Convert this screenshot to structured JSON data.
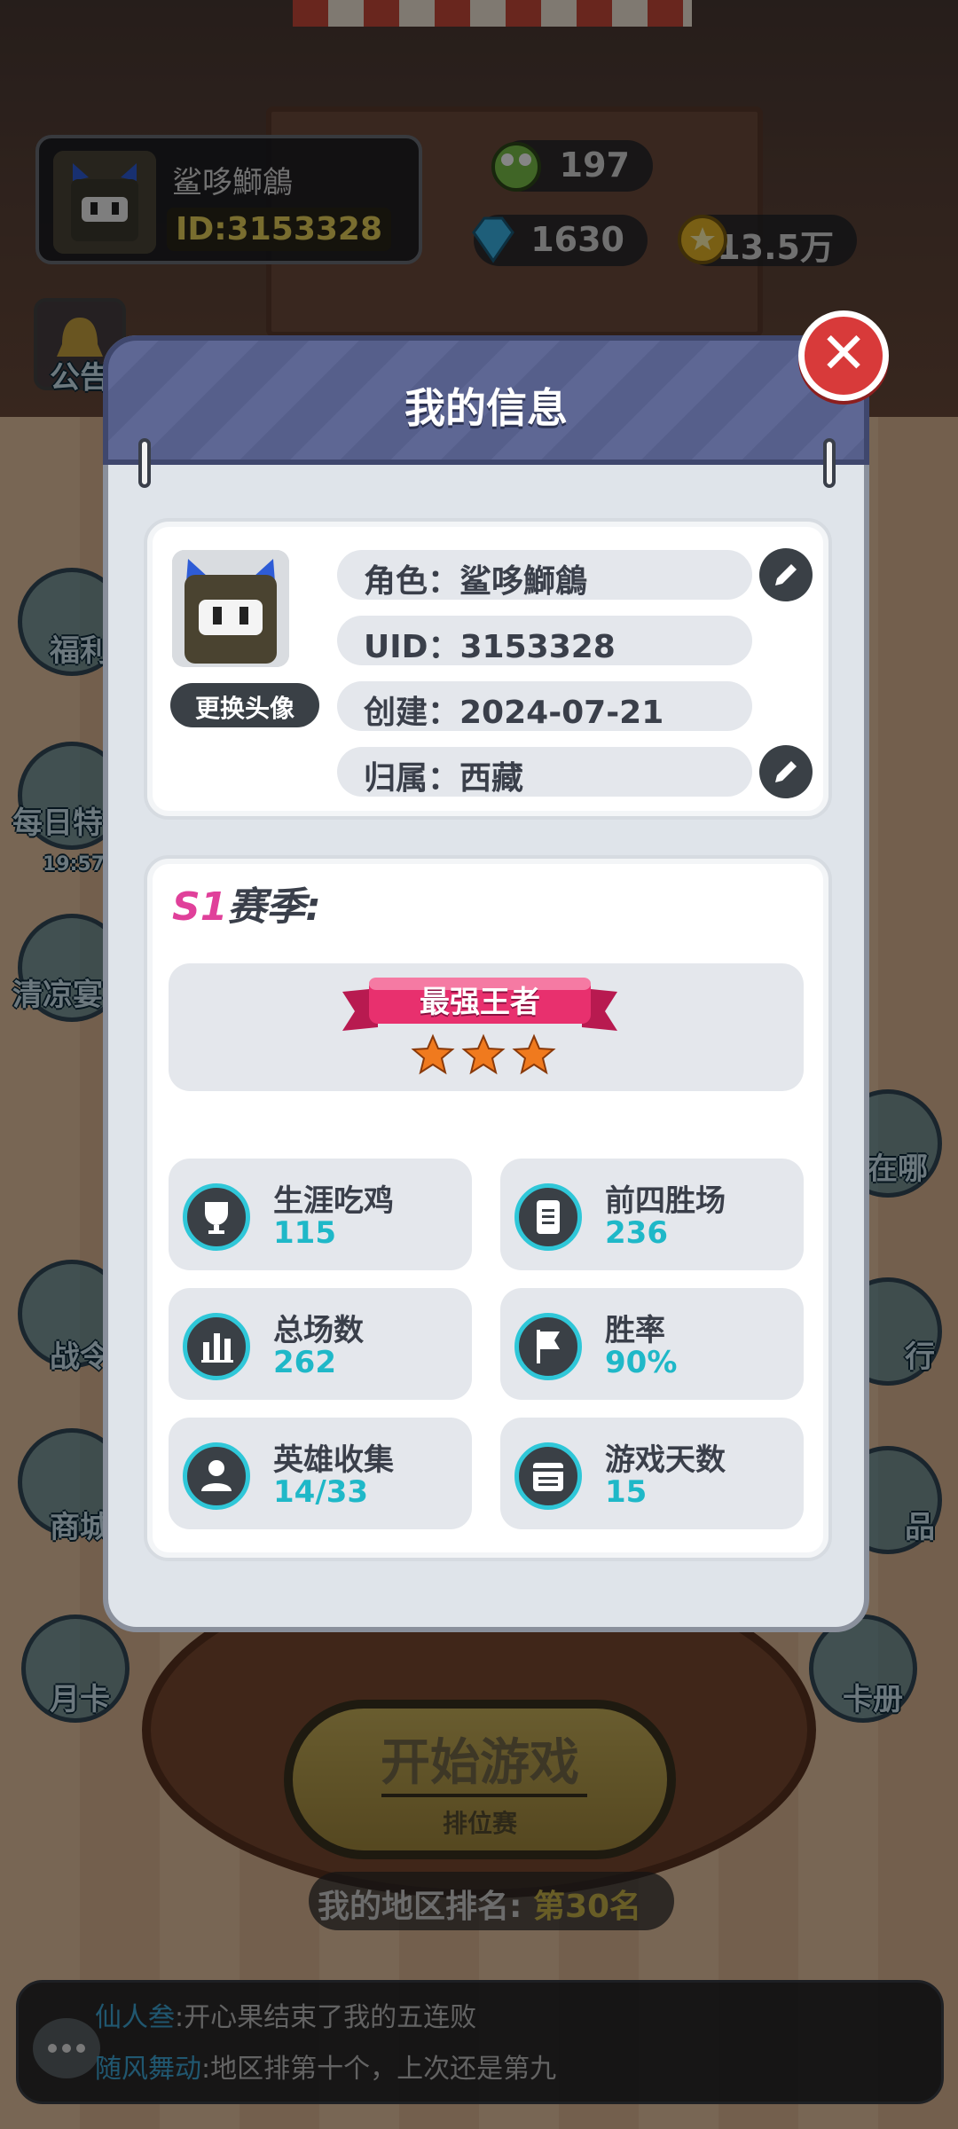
{
  "hud": {
    "player_name": "鲨哆鰤鶬",
    "player_id": "ID:3153328",
    "resource_top": "197",
    "diamonds": "1630",
    "coins": "13.5万"
  },
  "side_menu": {
    "notice": "公告",
    "welfare": "福利",
    "daily": "每日特",
    "daily_timer": "19:57",
    "summer": "清凉宴",
    "battle_pass": "战令",
    "shop": "商城",
    "monthly_card": "月卡",
    "where": "在哪",
    "rank": "行",
    "items": "品",
    "card_album": "卡册"
  },
  "start": {
    "title": "开始游戏",
    "mode": "排位赛"
  },
  "region_rank": {
    "label": "我的地区排名:",
    "value": "第30名"
  },
  "chat": [
    {
      "user": "仙人叁",
      "message": ":开心果结束了我的五连败"
    },
    {
      "user": "随风舞动",
      "message": ":地区排第十个，上次还是第九"
    }
  ],
  "modal": {
    "title": "我的信息",
    "change_avatar": "更换头像",
    "role": "角色：鲨哆鰤鶬",
    "uid": "UID：3153328",
    "created": "创建：2024-07-21",
    "region": "归属：西藏",
    "season_prefix": "S1",
    "season_suffix": "赛季:",
    "rank_title": "最强王者",
    "rank_stars": 3,
    "stats": [
      {
        "icon": "trophy-icon",
        "label": "生涯吃鸡",
        "value": "115"
      },
      {
        "icon": "clipboard-icon",
        "label": "前四胜场",
        "value": "236"
      },
      {
        "icon": "bar-chart-icon",
        "label": "总场数",
        "value": "262"
      },
      {
        "icon": "flag-icon",
        "label": "胜率",
        "value": "90%"
      },
      {
        "icon": "person-icon",
        "label": "英雄收集",
        "value": "14/33"
      },
      {
        "icon": "calendar-icon",
        "label": "游戏天数",
        "value": "15"
      }
    ]
  },
  "colors": {
    "accent_teal": "#1fb8c8",
    "season_pink": "#e0409a",
    "close_red": "#d83a3a",
    "header_blue": "#5e6794"
  }
}
